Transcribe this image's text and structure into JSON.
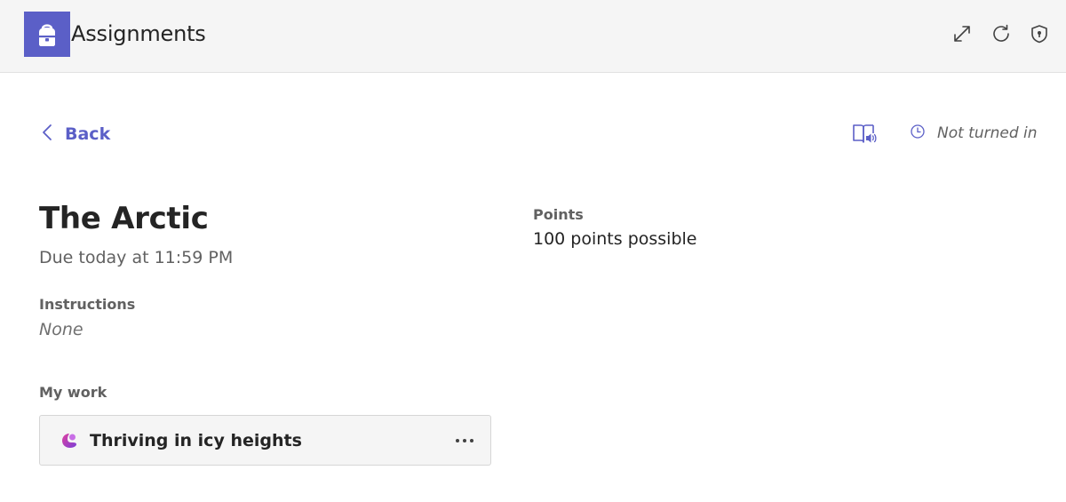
{
  "header": {
    "app_title": "Assignments",
    "icons": [
      "backpack-icon",
      "expand-icon",
      "refresh-icon",
      "shield-icon"
    ]
  },
  "nav": {
    "back_label": "Back"
  },
  "status": {
    "label": "Not turned in"
  },
  "assignment": {
    "title": "The Arctic",
    "due": "Due today at 11:59 PM",
    "instructions_label": "Instructions",
    "instructions_value": "None",
    "my_work_label": "My work",
    "work_items": [
      {
        "title": "Thriving in icy heights",
        "more_label": "···"
      }
    ],
    "points_label": "Points",
    "points_value": "100 points possible"
  },
  "colors": {
    "accent": "#5b5fc7",
    "header_bg": "#f5f5f5",
    "card_bg": "#f5f5f5",
    "muted_text": "#616161"
  }
}
